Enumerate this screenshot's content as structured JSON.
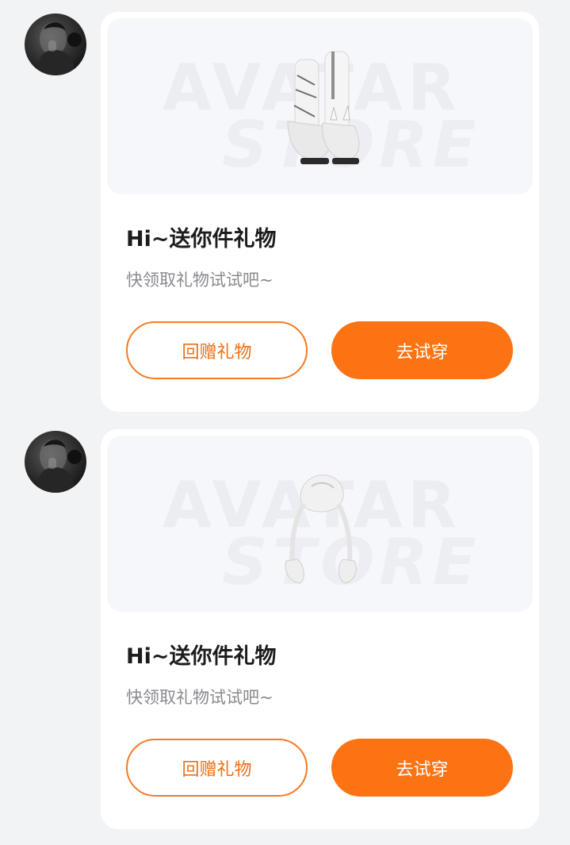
{
  "watermark": {
    "line1": "AVATAR",
    "line2": "STORE"
  },
  "messages": [
    {
      "product_icon": "boots-icon",
      "title": "Hi~送你件礼物",
      "subtitle": "快领取礼物试试吧~",
      "return_gift_label": "回赠礼物",
      "try_on_label": "去试穿"
    },
    {
      "product_icon": "hair-accessory-icon",
      "title": "Hi~送你件礼物",
      "subtitle": "快领取礼物试试吧~",
      "return_gift_label": "回赠礼物",
      "try_on_label": "去试穿"
    }
  ],
  "colors": {
    "accent": "#fb7313",
    "outline": "#f57b23",
    "background": "#f2f3f5"
  }
}
